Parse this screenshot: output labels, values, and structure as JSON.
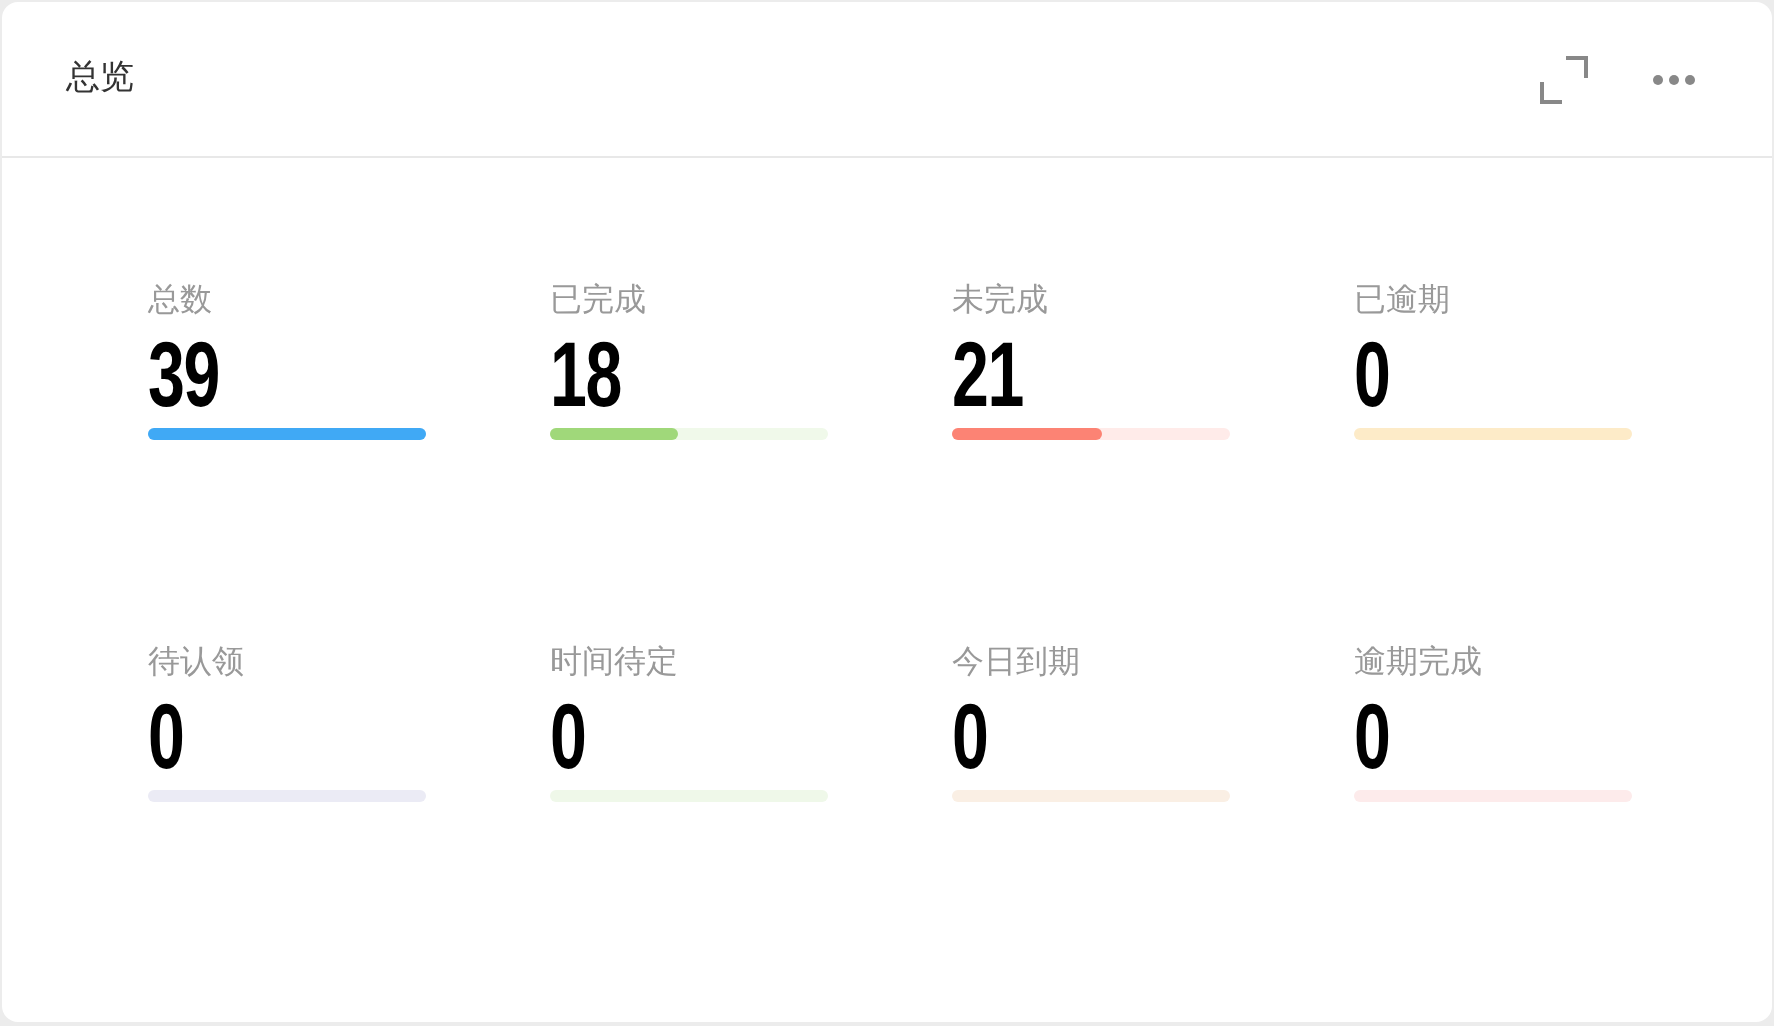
{
  "card": {
    "title": "总览"
  },
  "stats": [
    {
      "label": "总数",
      "value": "39",
      "level": 1,
      "color": "#40a9f5"
    },
    {
      "label": "已完成",
      "value": "18",
      "level": 0.46,
      "color": "#a0d87a"
    },
    {
      "label": "未完成",
      "value": "21",
      "level": 0.54,
      "color": "#fc8374"
    },
    {
      "label": "已逾期",
      "value": "0",
      "color": "#fdebc8"
    },
    {
      "label": "待认领",
      "value": "0",
      "color": "#ebebf5"
    },
    {
      "label": "时间待定",
      "value": "0",
      "color": "#eff8e9"
    },
    {
      "label": "今日到期",
      "value": "0",
      "color": "#faefe4"
    },
    {
      "label": "逾期完成",
      "value": "0",
      "color": "#fdebeb"
    }
  ]
}
